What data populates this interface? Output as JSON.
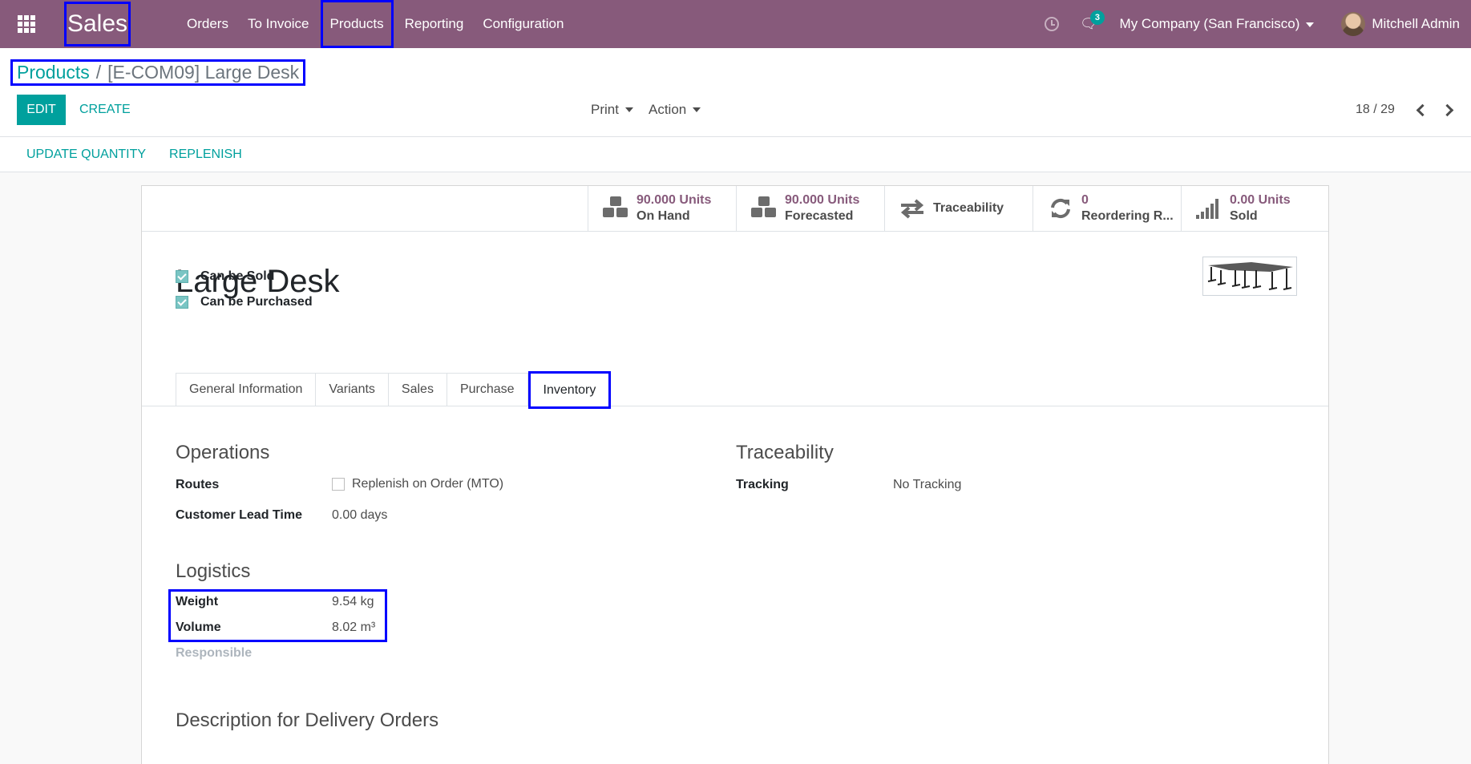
{
  "navbar": {
    "app_name": "Sales",
    "menu": [
      "Orders",
      "To Invoice",
      "Products",
      "Reporting",
      "Configuration"
    ],
    "chat_count": "3",
    "company": "My Company (San Francisco)",
    "user": "Mitchell Admin",
    "accent_color": "#875a7b"
  },
  "breadcrumb": {
    "parent": "Products",
    "separator": "/",
    "current": "[E-COM09] Large Desk"
  },
  "control": {
    "edit_label": "EDIT",
    "create_label": "CREATE",
    "print_label": "Print",
    "action_label": "Action",
    "pager": "18 / 29"
  },
  "statusbar": {
    "update_quantity": "UPDATE QUANTITY",
    "replenish": "REPLENISH"
  },
  "smart_buttons": {
    "on_hand": {
      "value": "90.000 Units",
      "label": "On Hand"
    },
    "forecasted": {
      "value": "90.000 Units",
      "label": "Forecasted"
    },
    "traceability": {
      "label": "Traceability"
    },
    "reordering": {
      "value": "0",
      "label": "Reordering R..."
    },
    "sold": {
      "value": "0.00 Units",
      "label": "Sold"
    }
  },
  "product": {
    "name": "Large Desk",
    "can_be_sold": "Can be Sold",
    "can_be_purchased": "Can be Purchased"
  },
  "tabs": [
    "General Information",
    "Variants",
    "Sales",
    "Purchase",
    "Inventory"
  ],
  "inventory": {
    "operations_title": "Operations",
    "routes_label": "Routes",
    "routes_option": "Replenish on Order (MTO)",
    "lead_time_label": "Customer Lead Time",
    "lead_time_value": "0.00 days",
    "traceability_title": "Traceability",
    "tracking_label": "Tracking",
    "tracking_value": "No Tracking",
    "logistics_title": "Logistics",
    "weight_label": "Weight",
    "weight_value": "9.54",
    "weight_unit": "kg",
    "volume_label": "Volume",
    "volume_value": "8.02",
    "volume_unit": "m³",
    "responsible_label": "Responsible",
    "description_title": "Description for Delivery Orders"
  }
}
